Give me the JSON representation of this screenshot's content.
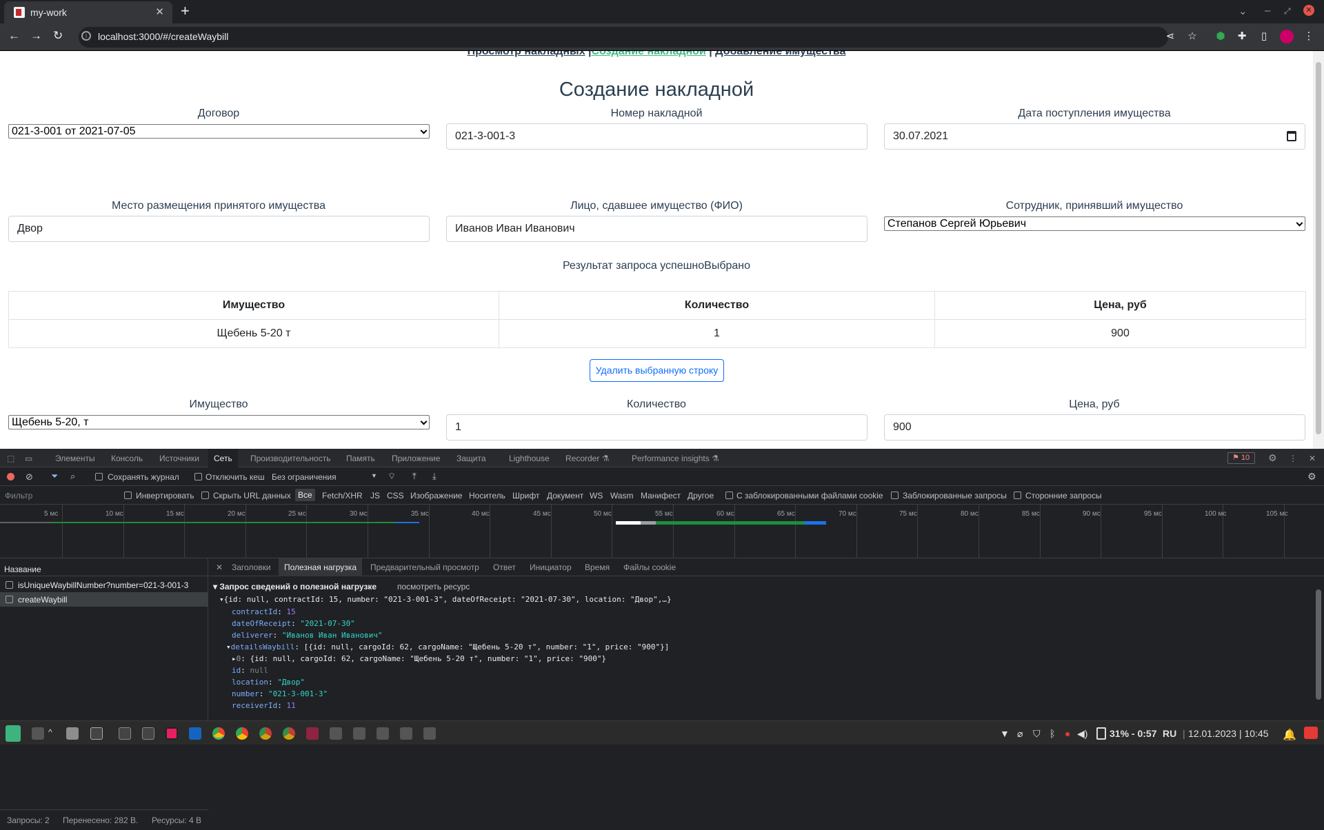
{
  "browser": {
    "tab_title": "my-work",
    "new_tab_symbol": "+",
    "url": "localhost:3000/#/createWaybill",
    "info_symbol": "i"
  },
  "page": {
    "nav": {
      "view_waybills": "Просмотр накладных",
      "sep1": " |",
      "create_waybill": "Создание накладной",
      "sep2": " | ",
      "add_property": "Добавление имущества"
    },
    "title": "Создание накладной",
    "contract": {
      "label": "Договор",
      "value": "021-3-001 от 2021-07-05"
    },
    "waybill_number": {
      "label": "Номер накладной",
      "value": "021-3-001-3"
    },
    "receipt_date": {
      "label": "Дата поступления имущества",
      "value": "30.07.2021"
    },
    "location": {
      "label": "Место размещения принятого имущества",
      "value": "Двор"
    },
    "deliverer": {
      "label": "Лицо, сдавшее имущество (ФИО)",
      "value": "Иванов Иван Иванович"
    },
    "receiver": {
      "label": "Сотрудник, принявший имущество",
      "value": "Степанов Сергей Юрьевич"
    },
    "result_text": "Результат запроса успешноВыбрано",
    "table": {
      "headers": [
        "Имущество",
        "Количество",
        "Цена, руб"
      ],
      "rows": [
        [
          "Щебень 5-20 т",
          "1",
          "900"
        ]
      ]
    },
    "delete_button": "Удалить выбранную строку",
    "property": {
      "label": "Имущество",
      "value": "Щебень 5-20, т"
    },
    "quantity": {
      "label": "Количество",
      "value": "1"
    },
    "price": {
      "label": "Цена, руб",
      "value": "900"
    }
  },
  "devtools": {
    "tabs": [
      "Элементы",
      "Консоль",
      "Источники",
      "Сеть",
      "Производительность",
      "Память",
      "Приложение",
      "Защита",
      "Lighthouse",
      "Recorder ⚗",
      "Performance insights ⚗"
    ],
    "active_tab": "Сеть",
    "error_count": "10",
    "toolbar": {
      "preserve_log": "Сохранять журнал",
      "disable_cache": "Отключить кеш",
      "throttling": "Без ограничения"
    },
    "filter": {
      "placeholder": "Фильтр",
      "invert": "Инвертировать",
      "hide_data_urls": "Скрыть URL данных",
      "types": [
        "Все",
        "Fetch/XHR",
        "JS",
        "CSS",
        "Изображение",
        "Носитель",
        "Шрифт",
        "Документ",
        "WS",
        "Wasm",
        "Манифест",
        "Другое"
      ],
      "blocked_cookies": "С заблокированными файлами cookie",
      "blocked_requests": "Заблокированные запросы",
      "third_party": "Сторонние запросы"
    },
    "timeline_ticks": [
      "5 мс",
      "10 мс",
      "15 мс",
      "20 мс",
      "25 мс",
      "30 мс",
      "35 мс",
      "40 мс",
      "45 мс",
      "50 мс",
      "55 мс",
      "60 мс",
      "65 мс",
      "70 мс",
      "75 мс",
      "80 мс",
      "85 мс",
      "90 мс",
      "95 мс",
      "100 мс",
      "105 мс"
    ],
    "requests_header": "Название",
    "requests": [
      "isUniqueWaybillNumber?number=021-3-001-3",
      "createWaybill"
    ],
    "status": {
      "requests": "Запросы: 2",
      "transferred": "Перенесено: 282 B.",
      "resources": "Ресурсы: 4 B"
    },
    "detail_tabs": [
      "Заголовки",
      "Полезная нагрузка",
      "Предварительный просмотр",
      "Ответ",
      "Инициатор",
      "Время",
      "Файлы cookie"
    ],
    "active_detail_tab": "Полезная нагрузка",
    "payload": {
      "section_title": "Запрос сведений о полезной нагрузке",
      "view_source": "посмотреть ресурс",
      "summary": "{id: null, contractId: 15, number: \"021-3-001-3\", dateOfReceipt: \"2021-07-30\", location: \"Двор\",…}",
      "lines": [
        {
          "key": "contractId",
          "value": "15",
          "type": "n"
        },
        {
          "key": "dateOfReceipt",
          "value": "\"2021-07-30\"",
          "type": "s"
        },
        {
          "key": "deliverer",
          "value": "\"Иванов Иван Иванович\"",
          "type": "s"
        },
        {
          "key": "detailsWaybill",
          "value": "[{id: null, cargoId: 62, cargoName: \"Щебень 5-20 т\", number: \"1\", price: \"900\"}]",
          "type": "t"
        },
        {
          "key": "0",
          "value": "{id: null, cargoId: 62, cargoName: \"Щебень 5-20 т\", number: \"1\", price: \"900\"}",
          "type": "t"
        },
        {
          "key": "id",
          "value": "null",
          "type": "nl"
        },
        {
          "key": "location",
          "value": "\"Двор\"",
          "type": "s"
        },
        {
          "key": "number",
          "value": "\"021-3-001-3\"",
          "type": "s"
        },
        {
          "key": "receiverId",
          "value": "11",
          "type": "n"
        }
      ]
    }
  },
  "taskbar": {
    "battery": "31% - 0:57",
    "lang": "RU",
    "separator": "|",
    "datetime": "12.01.2023 | 10:45"
  }
}
